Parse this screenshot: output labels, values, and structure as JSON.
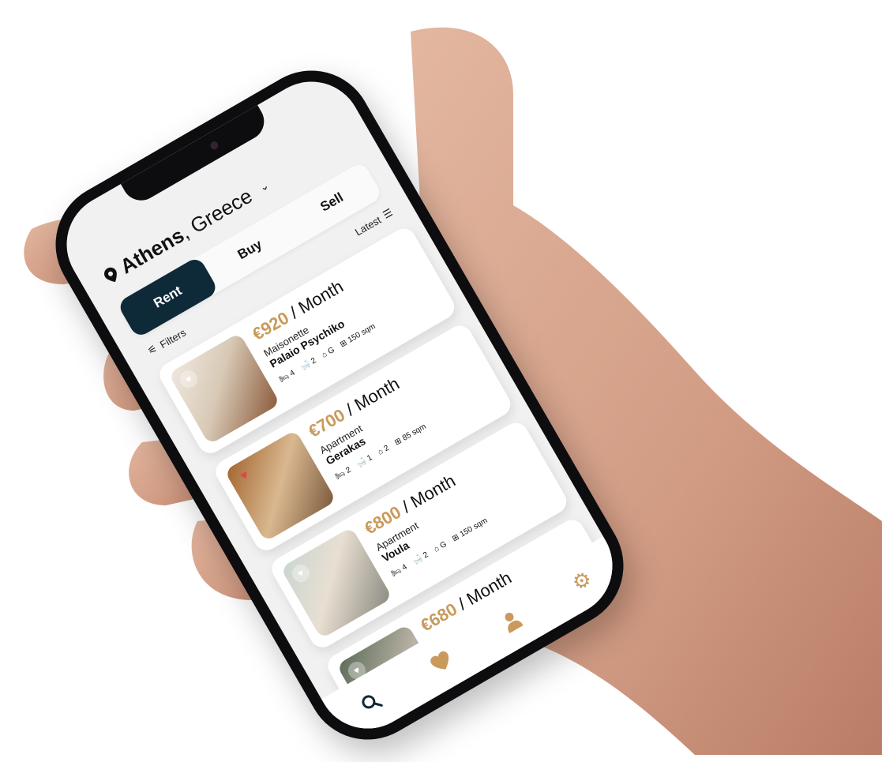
{
  "header": {
    "city": "Athens",
    "country": ", Greece"
  },
  "tabs": [
    {
      "label": "Rent",
      "active": true
    },
    {
      "label": "Buy",
      "active": false
    },
    {
      "label": "Sell",
      "active": false
    }
  ],
  "toolbar": {
    "filters_label": "Filters",
    "sort_label": "Latest"
  },
  "listings": [
    {
      "price": "€920",
      "period": " / Month",
      "type": "Maisonette",
      "location": "Palaio Psychiko",
      "bedrooms": "4",
      "bathrooms": "2",
      "floor": "G",
      "size": "150 sqm",
      "favorite": false
    },
    {
      "price": "€700",
      "period": " / Month",
      "type": "Apartment",
      "location": "Gerakas",
      "bedrooms": "2",
      "bathrooms": "1",
      "floor": "2",
      "size": "85 sqm",
      "favorite": true
    },
    {
      "price": "€800",
      "period": " / Month",
      "type": "Apartment",
      "location": "Voula",
      "bedrooms": "4",
      "bathrooms": "2",
      "floor": "G",
      "size": "150 sqm",
      "favorite": false
    },
    {
      "price": "€680",
      "period": " / Month",
      "favorite": false
    }
  ],
  "colors": {
    "accent_gold": "#c99a5b",
    "primary_navy": "#0e2a38",
    "favorite_red": "#e0464a"
  },
  "nav": {
    "items": [
      "search-icon",
      "heart-icon",
      "user-icon",
      "gear-icon"
    ]
  }
}
